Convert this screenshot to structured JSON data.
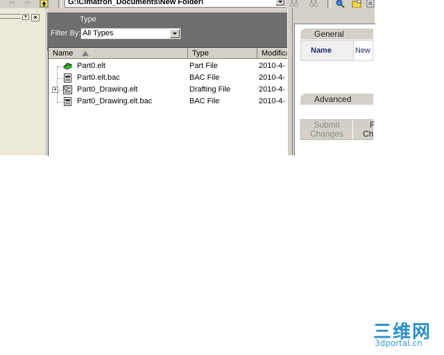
{
  "toolbar": {
    "back_icon": "arrow-left-icon",
    "forward_icon": "arrow-right-icon",
    "up_icon": "folder-up-icon",
    "path": "G:\\Cimatron_Documents\\New Folder\\",
    "find_icon": "binoculars-icon",
    "find_next_icon": "binoculars-icon",
    "search_icon": "magnifier-icon",
    "new_folder_icon": "new-folder-icon",
    "views_icon": "views-icon"
  },
  "filter": {
    "type_label": "Type",
    "filter_label": "Filter By:",
    "selected": "All Types"
  },
  "list": {
    "columns": [
      "Name",
      "Type",
      "Modifica"
    ],
    "rows": [
      {
        "name": "Part0.elt",
        "type": "Part File",
        "modified": "2010-4-",
        "icon": "part-file-icon"
      },
      {
        "name": "Part0.elt.bac",
        "type": "BAC File",
        "modified": "2010-4-",
        "icon": "backup-file-icon"
      },
      {
        "name": "Part0_Drawing.elt",
        "type": "Drafting File",
        "modified": "2010-4-",
        "icon": "drafting-file-icon"
      },
      {
        "name": "Part0_Drawing.elt.bac",
        "type": "BAC File",
        "modified": "2010-4-",
        "icon": "backup-file-icon"
      }
    ]
  },
  "properties": {
    "general_label": "General",
    "name_label": "Name",
    "name_value": "New",
    "advanced_label": "Advanced",
    "submit_label_1": "Submit",
    "submit_label_2": "Changes",
    "discard_label_1": "F",
    "discard_label_2": "Ch"
  },
  "watermark": {
    "cn": "三维网",
    "en": "3dportal.cn"
  },
  "colors": {
    "chrome": "#d4d0c8",
    "filter_bg": "#6e6e6e",
    "name_label": "#1a2a6c",
    "watermark": "#2a8fc8"
  }
}
